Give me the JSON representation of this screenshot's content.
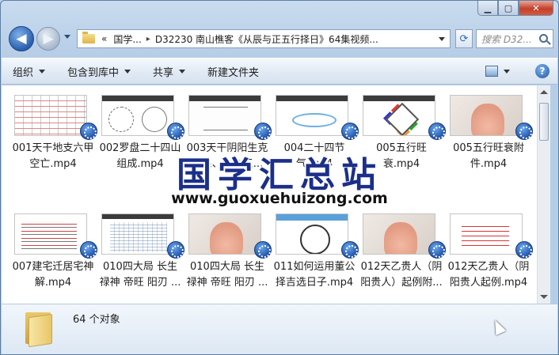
{
  "address": {
    "breadcrumbs": [
      "«",
      "国学...",
      "D32230 南山樵客《从辰与正五行择日》64集视频..."
    ],
    "separator": "▸"
  },
  "search": {
    "placeholder": "搜索 D32..."
  },
  "toolbar": {
    "organize": "组织",
    "include_in_library": "包含到库中",
    "share": "共享",
    "new_folder": "新建文件夹"
  },
  "files": [
    {
      "name": "001天干地支六甲空亡.mp4",
      "thumb": "table"
    },
    {
      "name": "002罗盘二十四山组成.mp4",
      "thumb": "grid"
    },
    {
      "name": "003天干阴阳生克关系、化合五...",
      "thumb": "diag"
    },
    {
      "name": "004二十四节气.mp4",
      "thumb": "flow"
    },
    {
      "name": "005五行旺衰.mp4",
      "thumb": "five"
    },
    {
      "name": "005五行旺衰附件.mp4",
      "thumb": "hand"
    },
    {
      "name": "007建宅迁居宅神解.mp4",
      "thumb": "doc"
    },
    {
      "name": "010四大局 长生禄神 帝旺 阳刃 ...",
      "thumb": "calendar"
    },
    {
      "name": "010四大局 长生禄神 帝旺 阳刃 ...",
      "thumb": "hand"
    },
    {
      "name": "011如何运用董公择吉选日子.mp4",
      "thumb": "circle"
    },
    {
      "name": "012天乙贵人（阴阳贵人）起例附...",
      "thumb": "hand"
    },
    {
      "name": "012天乙贵人（阴阳贵人起例.mp4",
      "thumb": "redtext"
    }
  ],
  "watermark": {
    "title": "国学汇总站",
    "url": "www.guoxuehuizong.com"
  },
  "status": {
    "count": "64 个对象"
  }
}
